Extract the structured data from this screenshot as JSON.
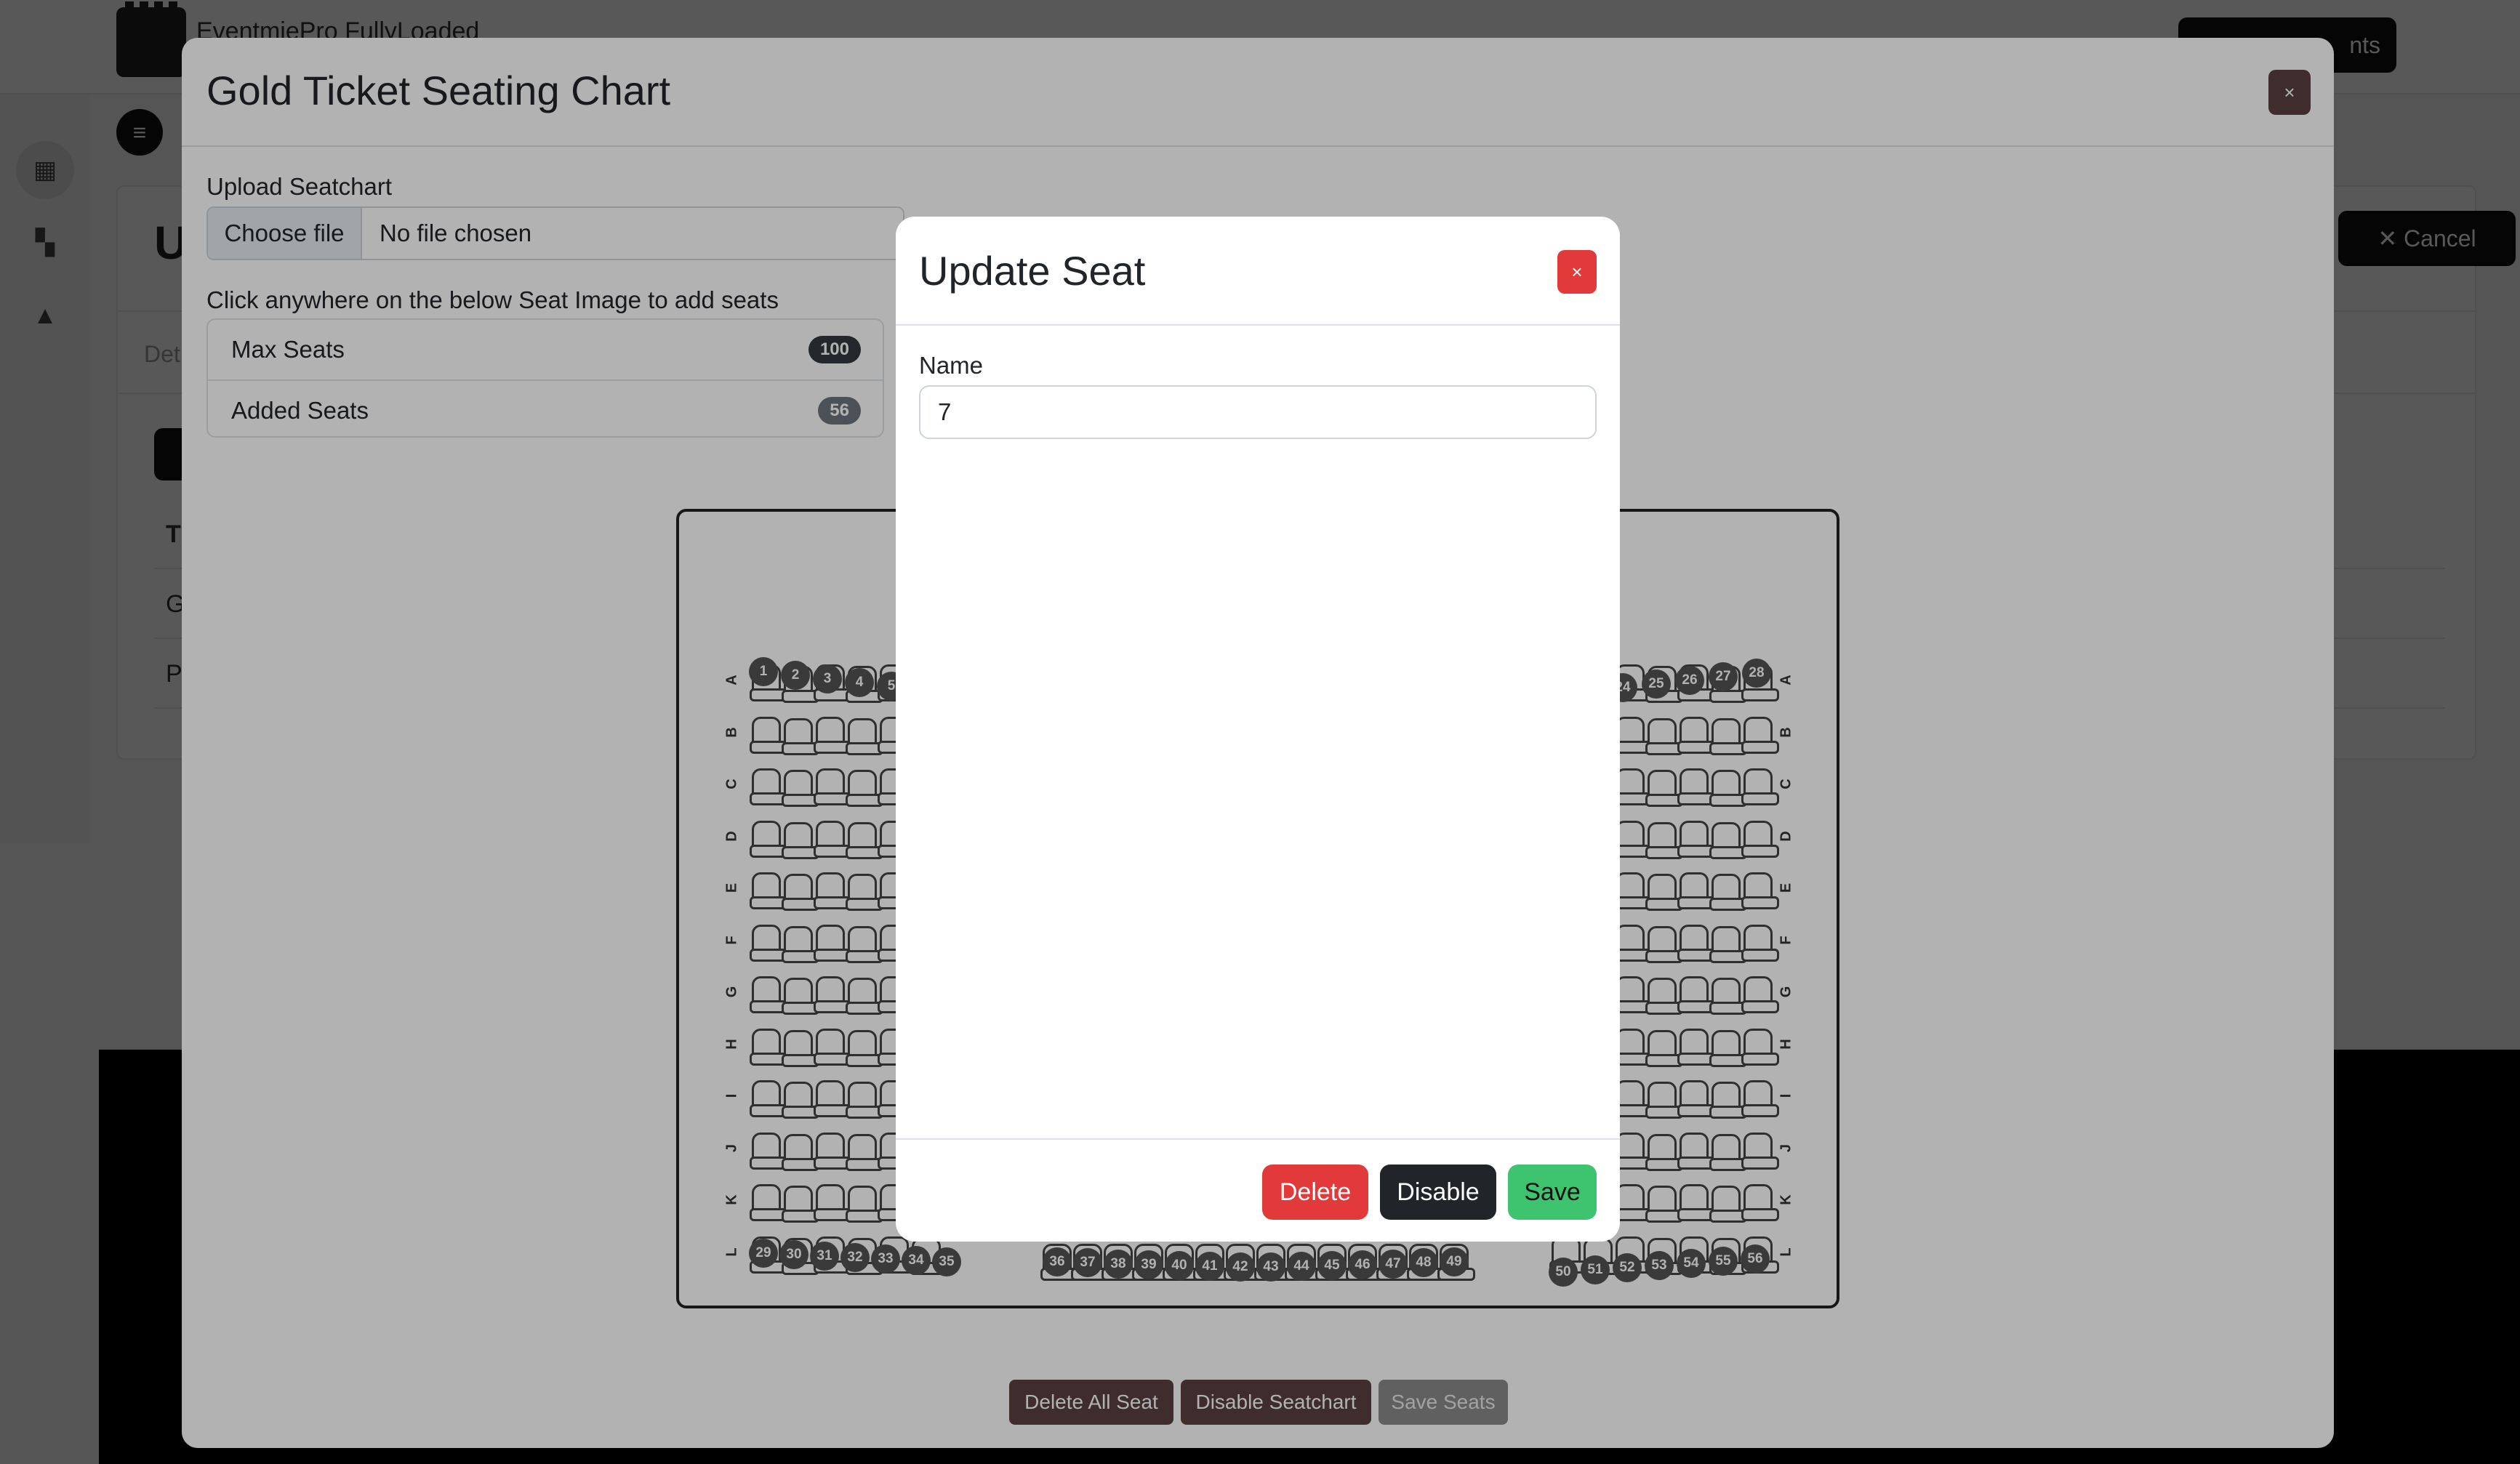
{
  "background": {
    "app_name": "EventmiePro FullyLoaded",
    "nav_text": "",
    "events_button": "nts",
    "page_title_initial": "U",
    "tab_label": "Det",
    "table_rows": [
      "T",
      "G",
      "P"
    ],
    "cancel_button": "✕ Cancel"
  },
  "seatchart_modal": {
    "title": "Gold Ticket Seating Chart",
    "close_label": "×",
    "upload_label": "Upload Seatchart",
    "choose_file_label": "Choose file",
    "file_status": "No file chosen",
    "instruction": "Click anywhere on the below Seat Image to add seats",
    "max_seats_label": "Max Seats",
    "max_seats_value": "100",
    "added_seats_label": "Added Seats",
    "added_seats_value": "56",
    "row_labels": [
      "A",
      "B",
      "C",
      "D",
      "E",
      "F",
      "G",
      "H",
      "I",
      "J",
      "K",
      "L"
    ],
    "seat_numbers_row_a_left": [
      "1",
      "2",
      "3",
      "4",
      "5"
    ],
    "seat_numbers_row_a_right": [
      "24",
      "25",
      "26",
      "27",
      "28"
    ],
    "seat_numbers_row_l_left": [
      "29",
      "30",
      "31",
      "32",
      "33",
      "34",
      "35"
    ],
    "seat_numbers_row_l_center": [
      "36",
      "37",
      "38",
      "39",
      "40",
      "41",
      "42",
      "43",
      "44",
      "45",
      "46",
      "47",
      "48",
      "49"
    ],
    "seat_numbers_row_l_right": [
      "50",
      "51",
      "52",
      "53",
      "54",
      "55",
      "56"
    ],
    "delete_all_button": "Delete All Seat",
    "disable_seatchart_button": "Disable Seatchart",
    "save_seats_button": "Save Seats"
  },
  "update_seat_modal": {
    "title": "Update Seat",
    "close_label": "×",
    "name_label": "Name",
    "name_value": "7",
    "delete_button": "Delete",
    "disable_button": "Disable",
    "save_button": "Save"
  },
  "colors": {
    "danger": "#e23a3a",
    "dark": "#212529",
    "success": "#3ec36e",
    "footer_button": "#5b3f3f"
  }
}
